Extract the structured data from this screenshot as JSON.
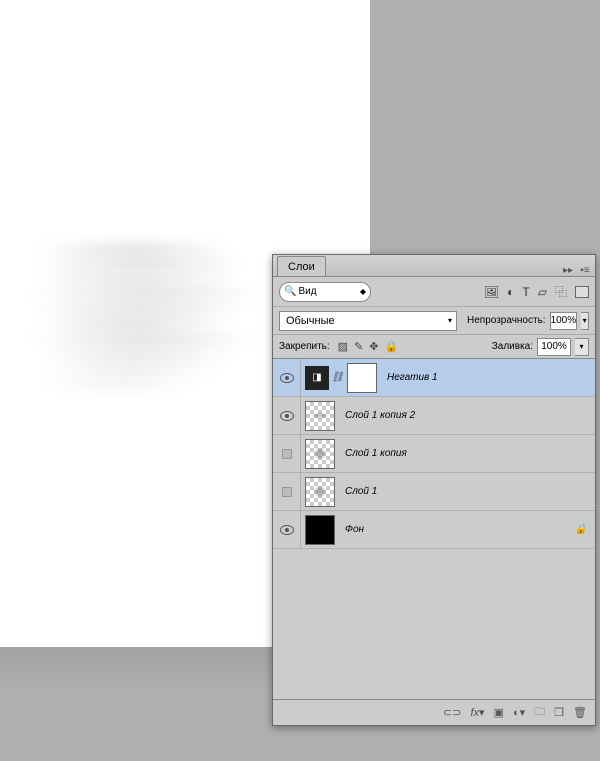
{
  "panel": {
    "tab_label": "Слои",
    "search_label": "Вид",
    "blend_mode": "Обычные",
    "opacity_label": "Непрозрачность:",
    "opacity_value": "100%",
    "lock_label": "Закрепить:",
    "fill_label": "Заливка:",
    "fill_value": "100%"
  },
  "layers": [
    {
      "name": "Негатив 1",
      "visible": true,
      "selected": true,
      "type": "adjustment"
    },
    {
      "name": "Слой 1 копия 2",
      "visible": true,
      "selected": false,
      "type": "smoke"
    },
    {
      "name": "Слой 1 копия",
      "visible": false,
      "selected": false,
      "type": "smoke2"
    },
    {
      "name": "Слой 1",
      "visible": false,
      "selected": false,
      "type": "smoke2"
    },
    {
      "name": "Фон",
      "visible": true,
      "selected": false,
      "type": "bg",
      "locked": true
    }
  ]
}
